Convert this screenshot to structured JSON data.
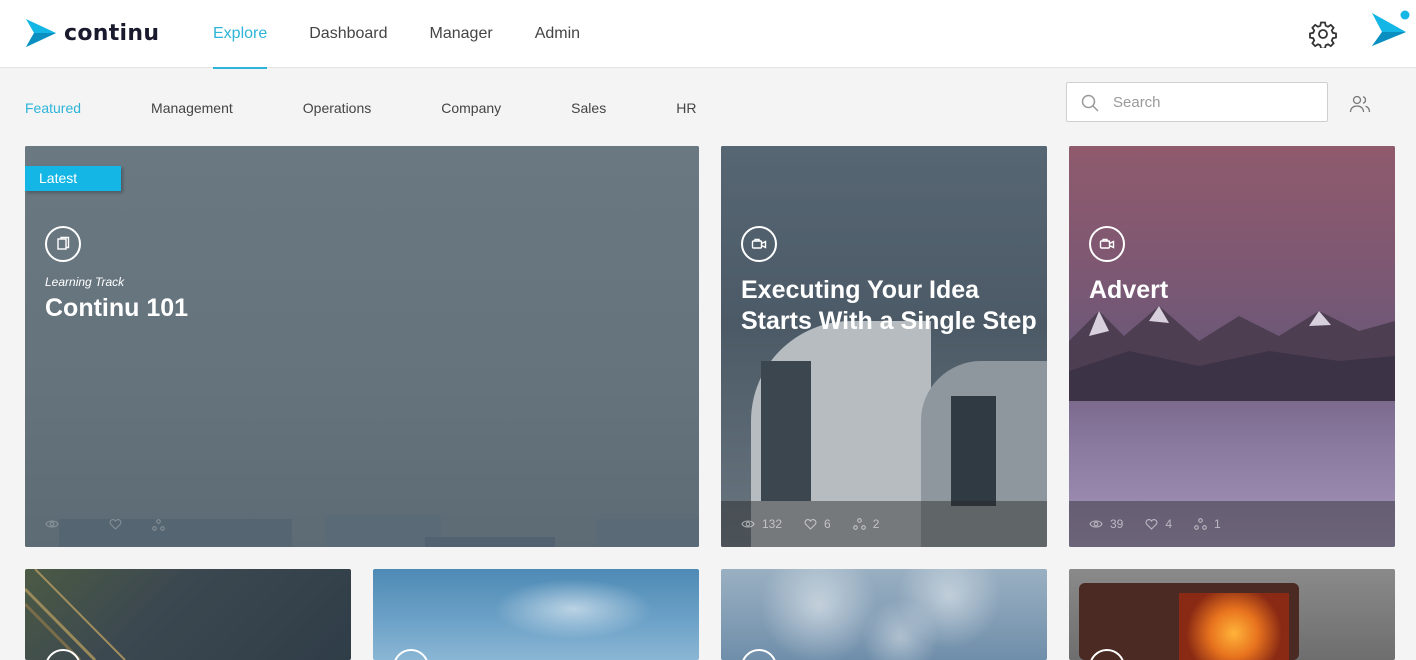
{
  "app": {
    "logo_text": "continu",
    "brand_color": "#2db4d8"
  },
  "main_nav": [
    {
      "label": "Explore",
      "active": true
    },
    {
      "label": "Dashboard",
      "active": false
    },
    {
      "label": "Manager",
      "active": false
    },
    {
      "label": "Admin",
      "active": false
    }
  ],
  "header_icons": [
    "gear-icon",
    "continu-logo-icon"
  ],
  "categories": [
    {
      "label": "Featured",
      "active": true
    },
    {
      "label": "Management",
      "active": false
    },
    {
      "label": "Operations",
      "active": false
    },
    {
      "label": "Company",
      "active": false
    },
    {
      "label": "Sales",
      "active": false
    },
    {
      "label": "HR",
      "active": false
    }
  ],
  "search": {
    "placeholder": "Search",
    "value": ""
  },
  "cards": [
    {
      "badge": "Latest",
      "type_icon": "book-icon",
      "subtitle": "Learning Track",
      "title": "Continu 101",
      "views": "",
      "likes": "",
      "shares": ""
    },
    {
      "type_icon": "video-icon",
      "title": "Executing Your Idea Starts With a Single Step",
      "views": "132",
      "likes": "6",
      "shares": "2"
    },
    {
      "type_icon": "video-icon",
      "title": "Advert",
      "views": "39",
      "likes": "4",
      "shares": "1"
    }
  ],
  "bottom_cards": [
    "book-icon",
    "generic-icon",
    "generic-icon",
    "video-icon"
  ]
}
